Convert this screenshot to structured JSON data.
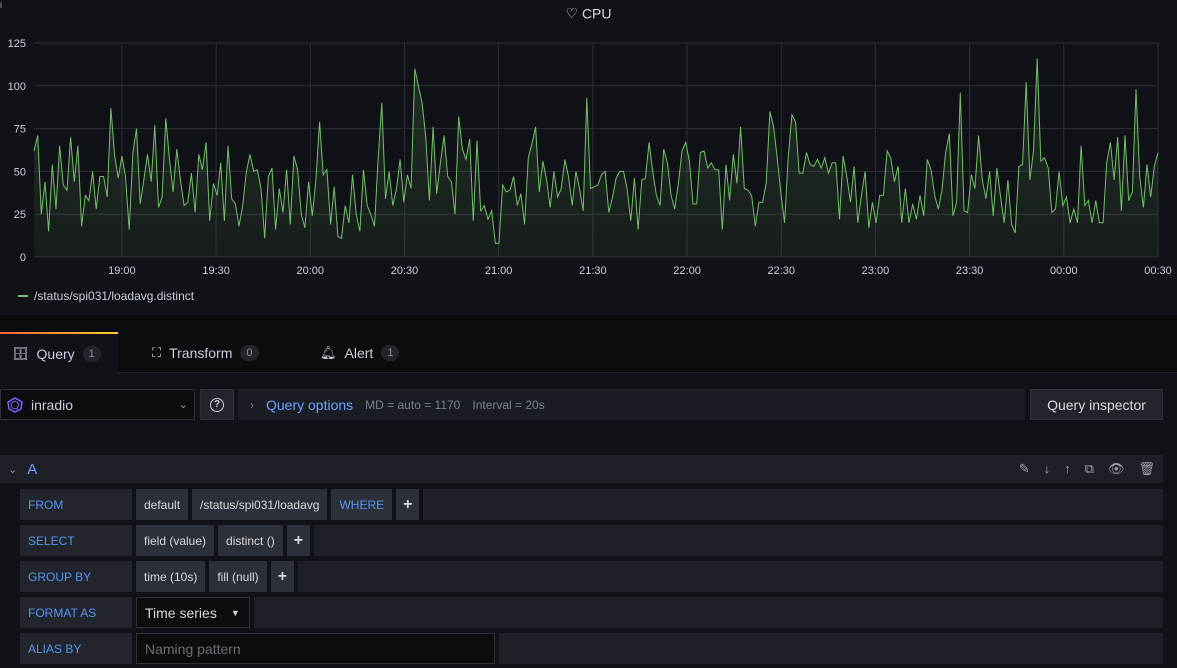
{
  "panel": {
    "title": "CPU",
    "title_icon": "heart-icon",
    "legend": "/status/spi031/loadavg.distinct"
  },
  "chart_data": {
    "type": "line",
    "title": "CPU",
    "x_range": [
      "18:32",
      "00:30"
    ],
    "ylim": [
      0,
      125
    ],
    "yticks": [
      "0",
      "25",
      "50",
      "75",
      "100",
      "125"
    ],
    "xticks": [
      "19:00",
      "19:30",
      "20:00",
      "20:30",
      "21:00",
      "21:30",
      "22:00",
      "22:30",
      "23:00",
      "23:30",
      "00:00",
      "00:30"
    ],
    "grid": true,
    "legend_placement": "bottom-left",
    "color": "#73bf69",
    "series": [
      {
        "name": "/status/spi031/loadavg.distinct",
        "values": [
          62,
          71,
          25,
          44,
          15,
          54,
          28,
          65,
          42,
          39,
          70,
          44,
          65,
          18,
          36,
          33,
          50,
          28,
          47,
          47,
          35,
          87,
          60,
          46,
          59,
          47,
          16,
          61,
          75,
          31,
          45,
          60,
          44,
          77,
          29,
          35,
          81,
          57,
          38,
          63,
          45,
          30,
          32,
          49,
          26,
          60,
          51,
          67,
          21,
          43,
          36,
          55,
          21,
          65,
          34,
          31,
          18,
          30,
          50,
          60,
          50,
          51,
          40,
          11,
          47,
          52,
          16,
          40,
          26,
          51,
          19,
          59,
          51,
          25,
          17,
          44,
          24,
          45,
          79,
          48,
          51,
          19,
          41,
          12,
          11,
          30,
          20,
          48,
          25,
          15,
          51,
          30,
          25,
          18,
          58,
          90,
          34,
          50,
          30,
          40,
          57,
          32,
          48,
          40,
          110,
          100,
          90,
          70,
          33,
          76,
          37,
          55,
          71,
          47,
          44,
          25,
          82,
          63,
          57,
          69,
          21,
          68,
          27,
          30,
          22,
          27,
          8,
          8,
          42,
          38,
          39,
          47,
          30,
          37,
          19,
          58,
          66,
          76,
          38,
          56,
          45,
          29,
          50,
          35,
          40,
          57,
          47,
          30,
          50,
          40,
          27,
          93,
          40,
          41,
          42,
          48,
          50,
          26,
          35,
          46,
          50,
          50,
          40,
          21,
          46,
          16,
          45,
          46,
          67,
          50,
          36,
          30,
          63,
          55,
          36,
          28,
          43,
          62,
          67,
          56,
          31,
          31,
          61,
          62,
          52,
          55,
          51,
          51,
          16,
          54,
          33,
          60,
          43,
          76,
          40,
          39,
          36,
          18,
          32,
          32,
          43,
          85,
          76,
          58,
          37,
          20,
          58,
          83,
          79,
          49,
          49,
          61,
          54,
          53,
          57,
          52,
          58,
          49,
          55,
          55,
          22,
          59,
          47,
          32,
          53,
          20,
          36,
          50,
          17,
          32,
          20,
          36,
          36,
          62,
          58,
          44,
          53,
          20,
          40,
          20,
          31,
          22,
          36,
          24,
          57,
          51,
          36,
          28,
          39,
          61,
          72,
          24,
          32,
          96,
          27,
          26,
          48,
          40,
          71,
          45,
          34,
          50,
          24,
          52,
          35,
          20,
          45,
          19,
          14,
          53,
          54,
          102,
          45,
          62,
          116,
          56,
          58,
          52,
          26,
          28,
          50,
          30,
          35,
          20,
          28,
          20,
          65,
          30,
          33,
          20,
          33,
          20,
          20,
          55,
          67,
          45,
          70,
          27,
          71,
          33,
          38,
          98,
          47,
          29,
          54,
          35,
          53,
          61
        ]
      }
    ]
  },
  "tabs": [
    {
      "label": "Query",
      "count": "1",
      "icon": "database-icon"
    },
    {
      "label": "Transform",
      "count": "0",
      "icon": "transform-icon"
    },
    {
      "label": "Alert",
      "count": "1",
      "icon": "bell-icon"
    }
  ],
  "datasource": {
    "name": "inradio"
  },
  "query_options": {
    "label": "Query options",
    "md": "MD = auto = 1170",
    "interval": "Interval = 20s"
  },
  "query_inspector": "Query inspector",
  "query": {
    "ref": "A",
    "from": {
      "label": "FROM",
      "policy": "default",
      "measurement": "/status/spi031/loadavg",
      "where": "WHERE"
    },
    "select": {
      "label": "SELECT",
      "field": "field (value)",
      "func": "distinct ()"
    },
    "group_by": {
      "label": "GROUP BY",
      "time": "time (10s)",
      "fill": "fill (null)"
    },
    "format_as": {
      "label": "FORMAT AS",
      "value": "Time series"
    },
    "alias_by": {
      "label": "ALIAS BY",
      "placeholder": "Naming pattern"
    }
  },
  "plus": "+"
}
